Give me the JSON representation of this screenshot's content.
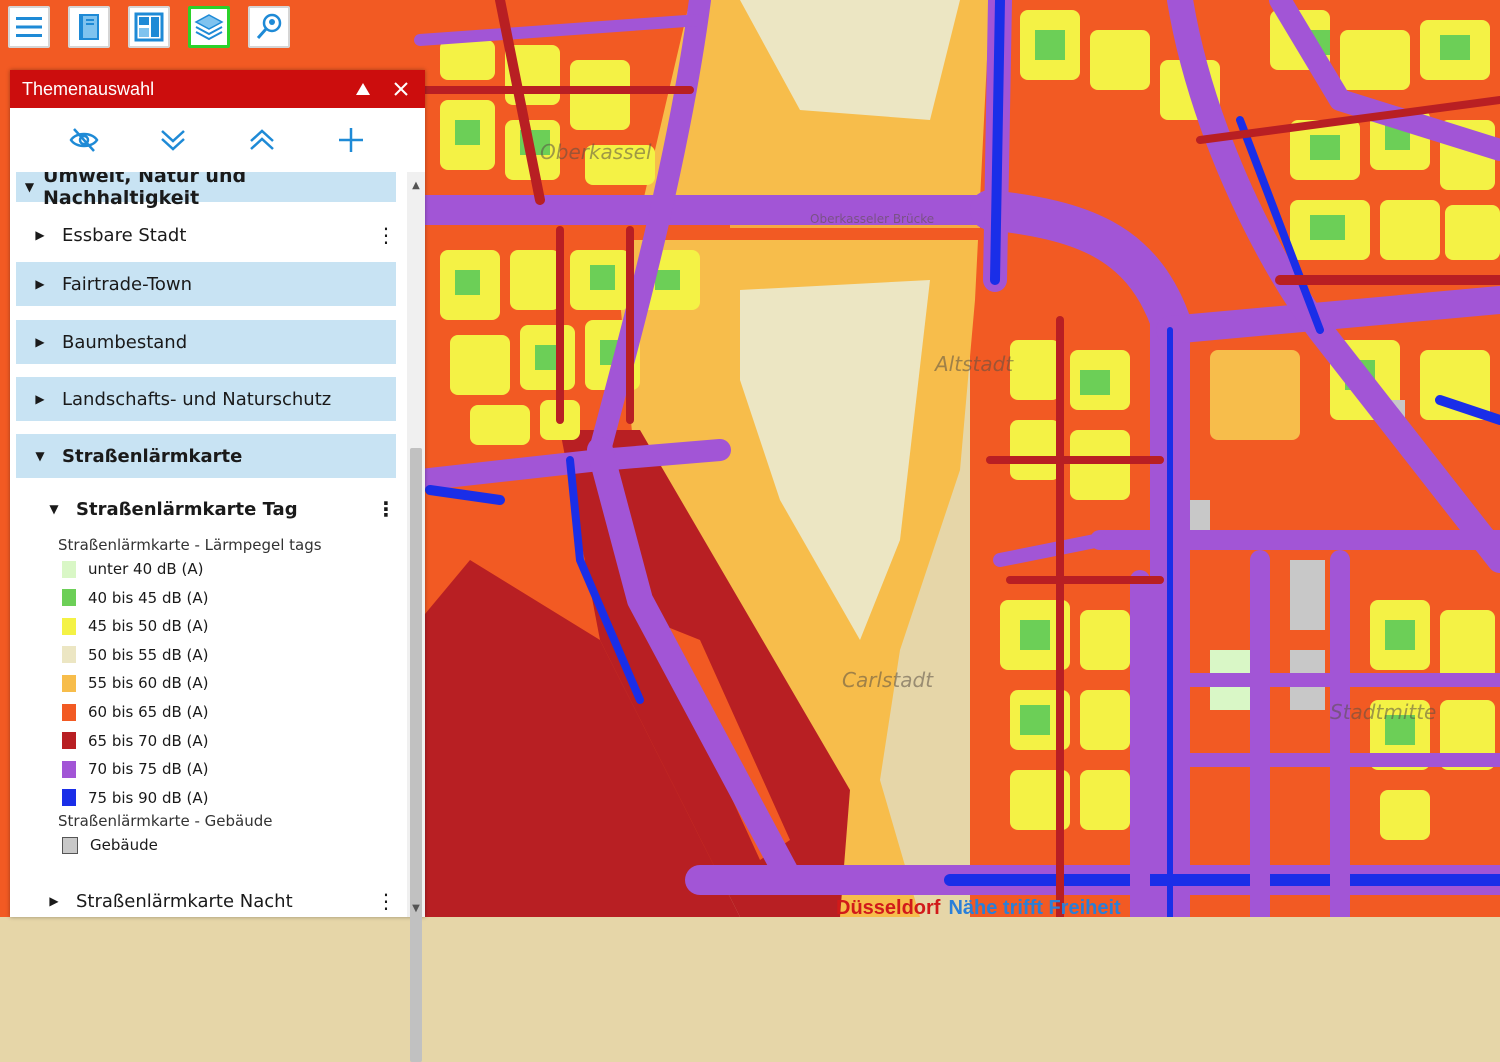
{
  "toolbar": {
    "buttons": [
      {
        "name": "menu-icon"
      },
      {
        "name": "book-icon"
      },
      {
        "name": "map-layout-icon"
      },
      {
        "name": "layers-icon",
        "active": true
      },
      {
        "name": "map-search-icon"
      }
    ]
  },
  "panel": {
    "title": "Themenauswahl",
    "tools": [
      "eye-off-icon",
      "chevron-double-down-icon",
      "chevron-double-up-icon",
      "plus-icon"
    ]
  },
  "tree": {
    "category": "Umwelt, Natur und Nachhaltigkeit",
    "items": [
      {
        "label": "Essbare Stadt"
      },
      {
        "label": "Fairtrade-Town"
      },
      {
        "label": "Baumbestand"
      },
      {
        "label": "Landschafts- und Naturschutz"
      },
      {
        "label": "Straßenlärmkarte"
      }
    ],
    "sublayers": [
      {
        "label": "Straßenlärmkarte Tag"
      },
      {
        "label": "Straßenlärmkarte Nacht"
      }
    ]
  },
  "legend": {
    "title_tags": "Straßenlärmkarte - Lärmpegel tags",
    "levels": [
      {
        "label": "unter 40 dB (A)",
        "color": "#d9f7c6"
      },
      {
        "label": "40 bis 45 dB (A)",
        "color": "#6ccf57"
      },
      {
        "label": "45 bis 50 dB (A)",
        "color": "#f4f245"
      },
      {
        "label": "50 bis 55 dB (A)",
        "color": "#ece6c3"
      },
      {
        "label": "55 bis 60 dB (A)",
        "color": "#f7bd4b"
      },
      {
        "label": "60 bis 65 dB (A)",
        "color": "#f25a23"
      },
      {
        "label": "65 bis 70 dB (A)",
        "color": "#b81f23"
      },
      {
        "label": "70 bis 75 dB (A)",
        "color": "#a255d6"
      },
      {
        "label": "75 bis 90 dB (A)",
        "color": "#1a2ee8"
      }
    ],
    "title_buildings": "Straßenlärmkarte - Gebäude",
    "building": {
      "label": "Gebäude",
      "color": "#c8c8c8"
    }
  },
  "map": {
    "labels": {
      "oberkassel": "Oberkassel",
      "bruecke": "Oberkasseler Brücke",
      "altstadt": "Altstadt",
      "carlstadt": "Carlstadt",
      "stadtmitte": "Stadtmitte"
    }
  },
  "branding": {
    "city": "Düsseldorf",
    "slogan": "Nähe trifft Freiheit"
  }
}
